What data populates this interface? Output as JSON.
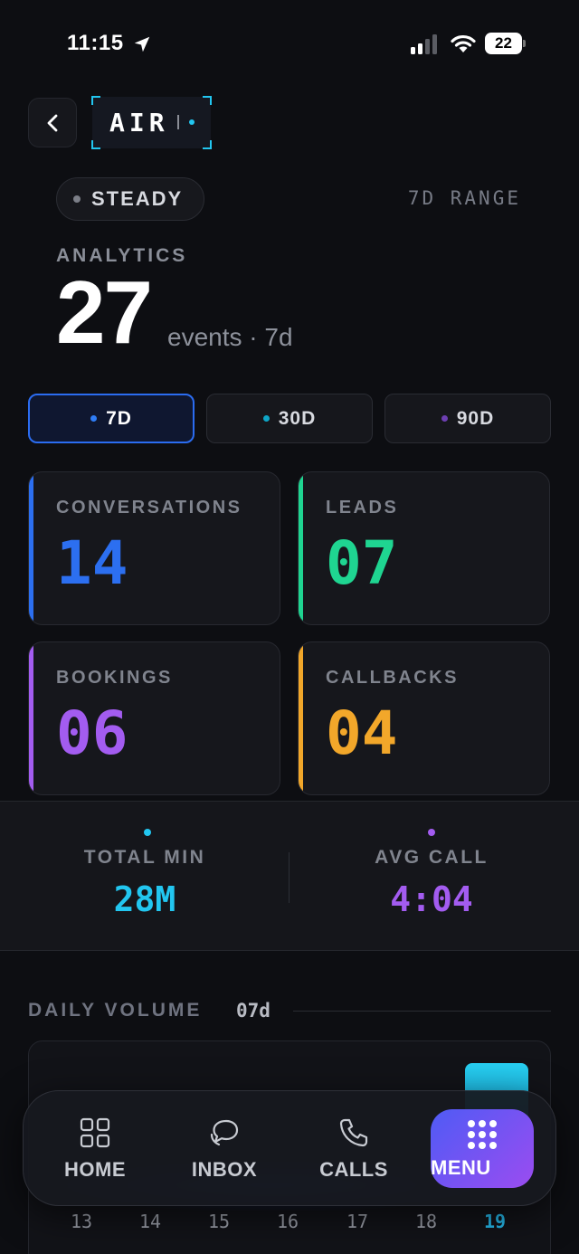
{
  "status_bar": {
    "time": "11:15",
    "battery": "22"
  },
  "header": {
    "brand": "AIR"
  },
  "state": {
    "status": "STEADY",
    "range_label": "7D RANGE"
  },
  "analytics": {
    "label": "ANALYTICS",
    "count": "27",
    "unit": "events · 7d"
  },
  "range_tabs": [
    {
      "label": "7D",
      "dot_color": "#2f7df6",
      "active": true
    },
    {
      "label": "30D",
      "dot_color": "#0ea5c6",
      "active": false
    },
    {
      "label": "90D",
      "dot_color": "#6d3fb2",
      "active": false
    }
  ],
  "metrics": [
    {
      "label": "CONVERSATIONS",
      "value": "14",
      "color": "#2c6ff0"
    },
    {
      "label": "LEADS",
      "value": "07",
      "color": "#1fd591"
    },
    {
      "label": "BOOKINGS",
      "value": "06",
      "color": "#a35cf0"
    },
    {
      "label": "CALLBACKS",
      "value": "04",
      "color": "#f2a72a"
    }
  ],
  "summary": [
    {
      "label": "TOTAL MIN",
      "value": "28M",
      "color": "#22c6f0"
    },
    {
      "label": "AVG CALL",
      "value": "4:04",
      "color": "#a35cf0"
    }
  ],
  "daily_volume": {
    "label": "DAILY VOLUME",
    "range": "07d",
    "days": [
      "13",
      "14",
      "15",
      "16",
      "17",
      "18",
      "19"
    ],
    "today": "19"
  },
  "nav": {
    "home": "HOME",
    "inbox": "INBOX",
    "calls": "CALLS",
    "menu": "MENU"
  }
}
